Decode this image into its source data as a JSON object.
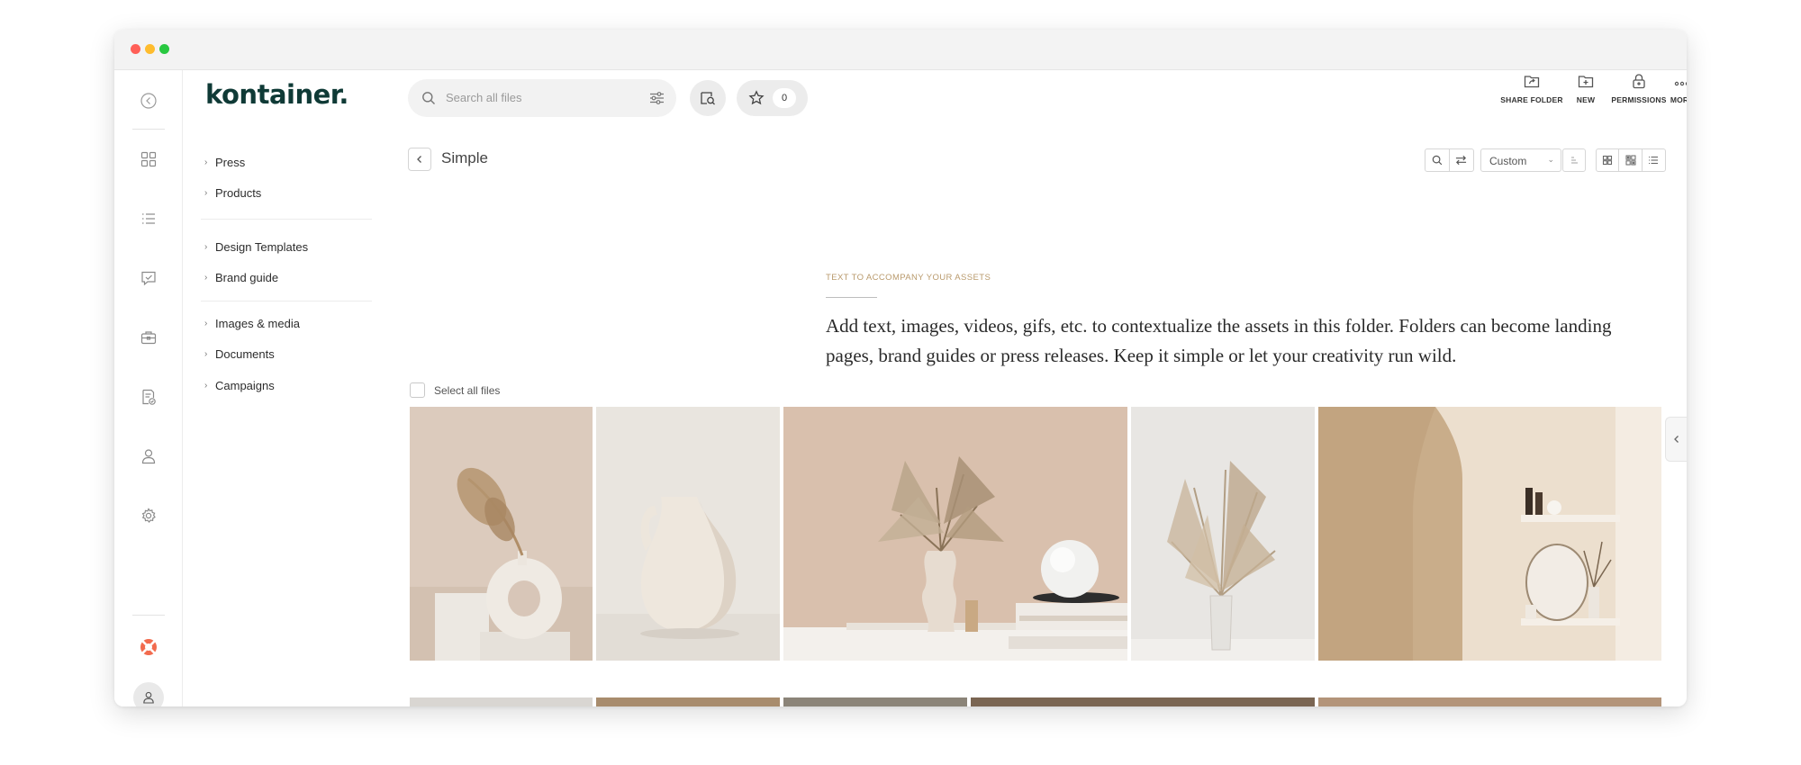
{
  "brand": {
    "logo_text": "kontainer."
  },
  "search": {
    "placeholder": "Search all files"
  },
  "favorites": {
    "count": "0"
  },
  "top_actions": [
    {
      "label": "SHARE FOLDER",
      "icon": "share-folder-icon"
    },
    {
      "label": "NEW",
      "icon": "new-folder-icon"
    },
    {
      "label": "PERMISSIONS",
      "icon": "lock-icon"
    },
    {
      "label": "MORE",
      "icon": "more-dots-icon"
    }
  ],
  "sidebar_tree": [
    {
      "label": "Press"
    },
    {
      "label": "Products"
    },
    {
      "label": "Design Templates"
    },
    {
      "label": "Brand guide"
    },
    {
      "label": "Images & media"
    },
    {
      "label": "Documents"
    },
    {
      "label": "Campaigns"
    }
  ],
  "rail_icons": [
    "collapse-icon",
    "grid-icon",
    "list-icon",
    "approval-icon",
    "briefcase-icon",
    "document-check-icon",
    "user-icon",
    "settings-icon",
    "help-lifebuoy-icon",
    "avatar-icon"
  ],
  "folder": {
    "title": "Simple",
    "sort_value": "Custom",
    "kicker": "TEXT TO ACCOMPANY YOUR ASSETS",
    "description": "Add text, images, videos, gifs, etc. to contextualize the assets in this folder. Folders can become landing pages, brand guides or press releases. Keep it simple or let your creativity run wild.",
    "select_all_label": "Select all files"
  },
  "colors": {
    "brand": "#0f3a36",
    "kicker": "#b99a6c",
    "help": "#f26b4e"
  }
}
